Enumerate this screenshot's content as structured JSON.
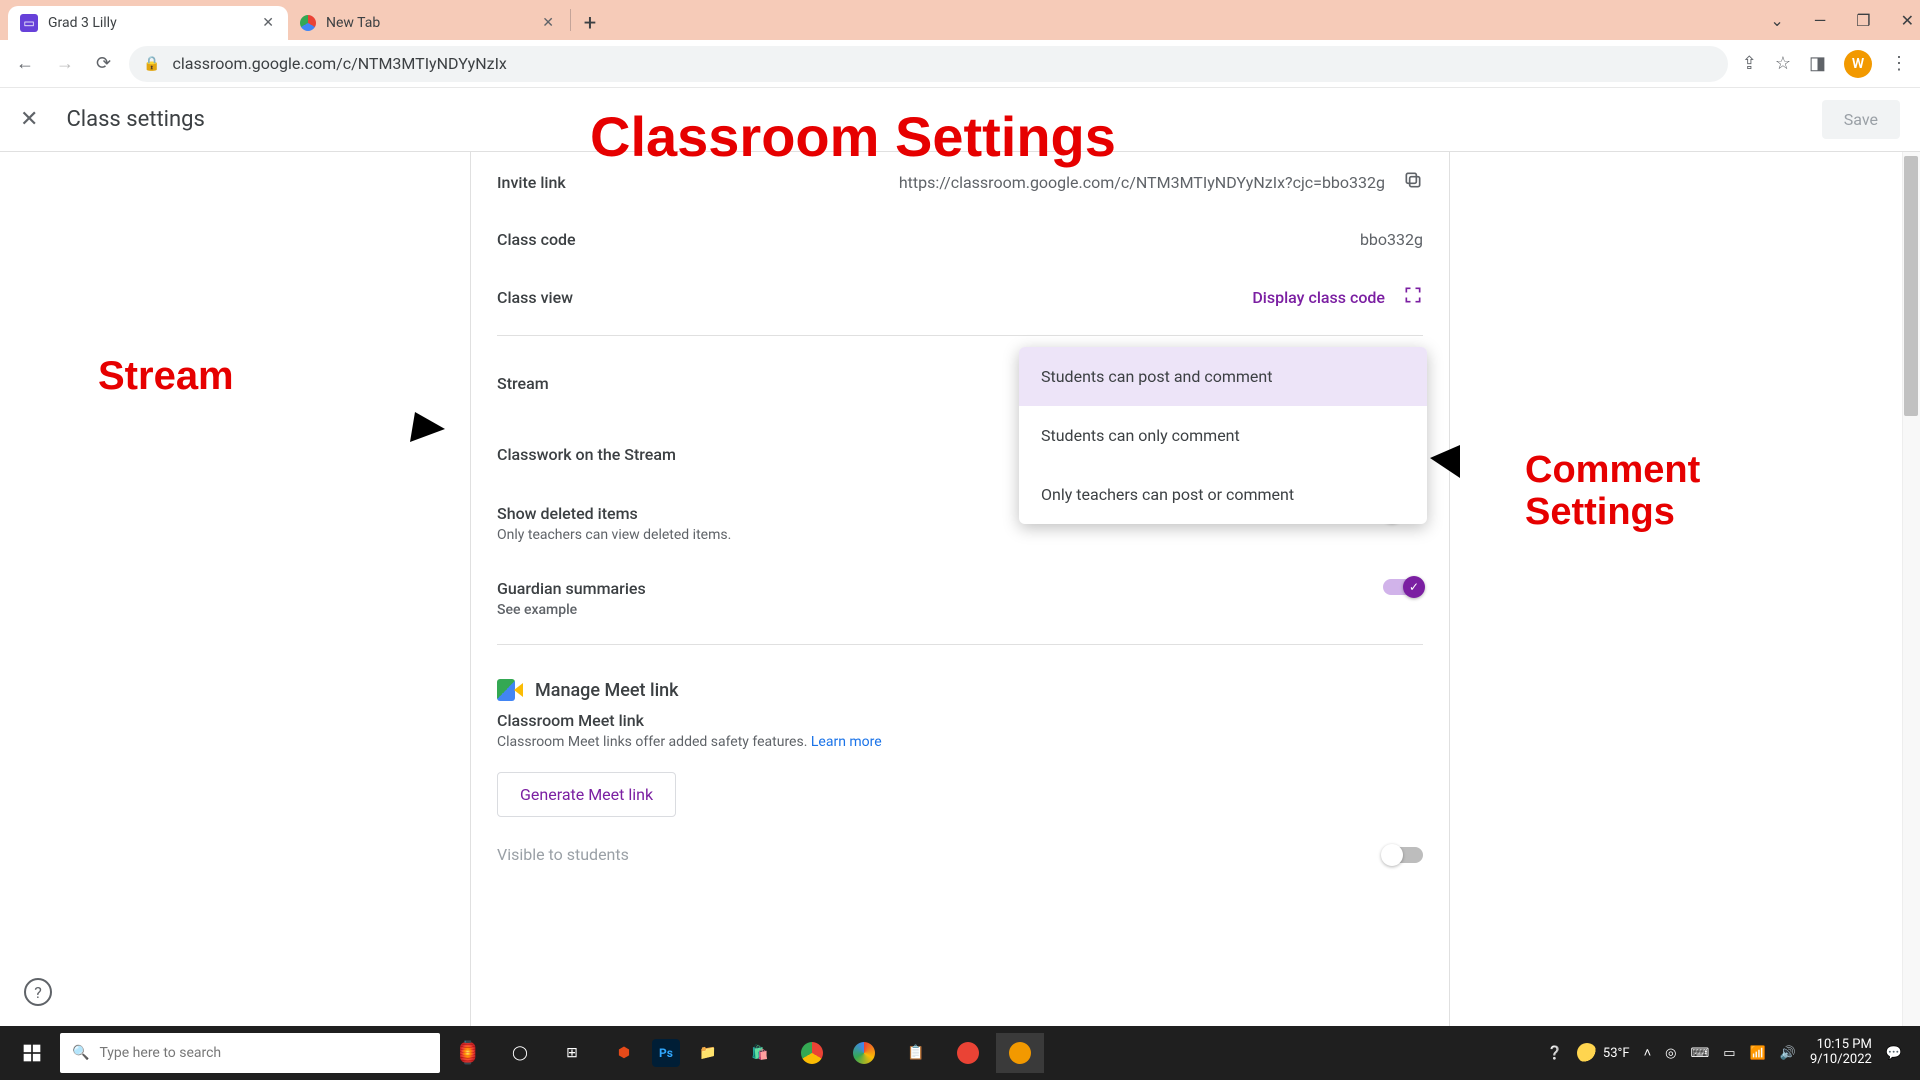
{
  "browser": {
    "tabs": [
      {
        "title": "Grad 3 Lilly"
      },
      {
        "title": "New Tab"
      }
    ],
    "url": "classroom.google.com/c/NTM3MTIyNDYyNzIx",
    "avatarLetter": "W"
  },
  "header": {
    "title": "Class settings",
    "save": "Save"
  },
  "settings": {
    "inviteLinkLabel": "Invite link",
    "inviteLinkValue": "https://classroom.google.com/c/NTM3MTIyNDYyNzIx?cjc=bbo332g",
    "classCodeLabel": "Class code",
    "classCodeValue": "bbo332g",
    "classViewLabel": "Class view",
    "classViewAction": "Display class code",
    "streamLabel": "Stream",
    "classworkLabel": "Classwork on the Stream",
    "showDeletedLabel": "Show deleted items",
    "showDeletedSub": "Only teachers can view deleted items.",
    "guardianLabel": "Guardian summaries",
    "guardianLink": "See example",
    "meetHeader": "Manage Meet link",
    "meetLinkTitle": "Classroom Meet link",
    "meetLinkSub": "Classroom Meet links offer added safety features. ",
    "learnMore": "Learn more",
    "generateBtn": "Generate Meet link",
    "visibleLabel": "Visible to students"
  },
  "dropdown": {
    "opt1": "Students can post and comment",
    "opt2": "Students can only comment",
    "opt3": "Only teachers can post or comment"
  },
  "annotations": {
    "title": "Classroom Settings",
    "stream": "Stream",
    "comment1": "Comment",
    "comment2": "Settings"
  },
  "taskbar": {
    "searchPlaceholder": "Type here to search",
    "temp": "53°F",
    "time": "10:15 PM",
    "date": "9/10/2022"
  }
}
